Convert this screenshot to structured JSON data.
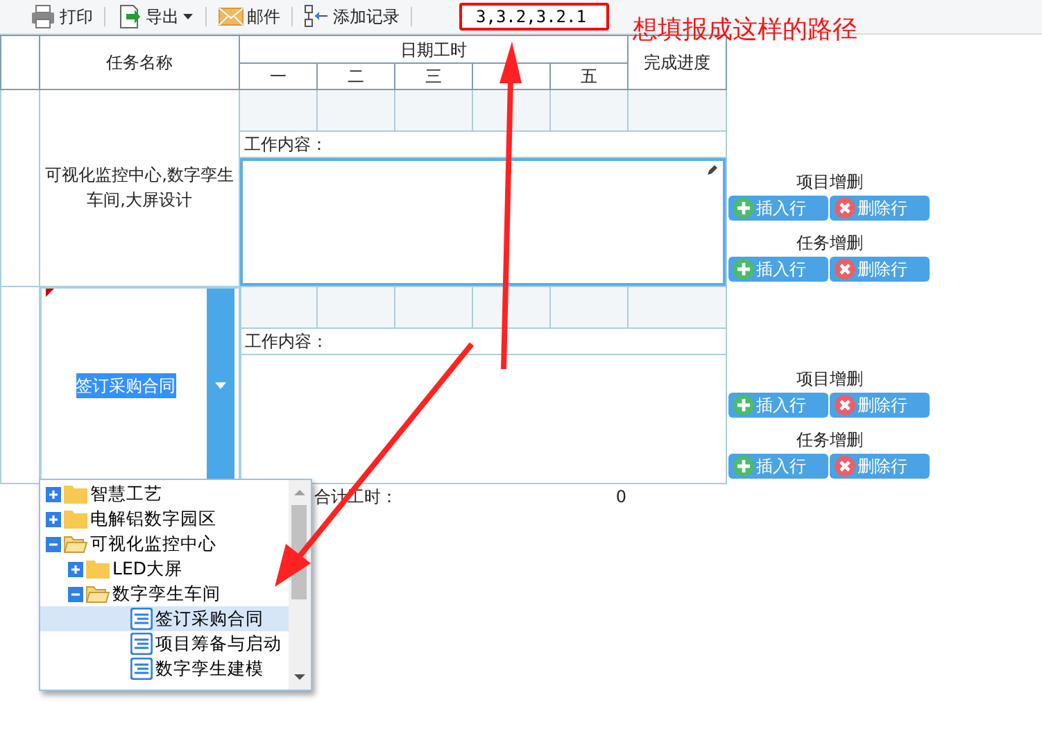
{
  "toolbar": [
    {
      "kind": "print",
      "label": "打印",
      "caret": false
    },
    {
      "kind": "export",
      "label": "导出",
      "caret": true
    },
    {
      "kind": "mail",
      "label": "邮件",
      "caret": false
    },
    {
      "kind": "add",
      "label": "添加记录",
      "caret": false
    }
  ],
  "path_field": {
    "value": "3,3.2,3.2.1"
  },
  "annotation": {
    "text": "想填报成这样的路径"
  },
  "table": {
    "columns": {
      "task": "任务名称",
      "dates": "日期工时",
      "days": [
        {
          "label": "一"
        },
        {
          "label": "二"
        },
        {
          "label": "三"
        },
        {
          "label": "五",
          "gap_before": true
        }
      ],
      "progress": "完成进度"
    },
    "rows": [
      {
        "task": "可视化监控中心,数字孪生车间,大屏设计",
        "selected": false,
        "editing": true,
        "work_label": "工作内容：",
        "actions": [
          {
            "label": "项目增删",
            "buttons": [
              {
                "kind": "insert",
                "label": "插入行"
              },
              {
                "kind": "delete",
                "label": "删除行"
              }
            ]
          },
          {
            "label": "任务增删",
            "buttons": [
              {
                "kind": "insert",
                "label": "插入行"
              },
              {
                "kind": "delete",
                "label": "删除行"
              }
            ]
          }
        ]
      },
      {
        "task": "签订采购合同",
        "selected": true,
        "editing": false,
        "work_label": "工作内容：",
        "actions": [
          {
            "label": "项目增删",
            "buttons": [
              {
                "kind": "insert",
                "label": "插入行"
              },
              {
                "kind": "delete",
                "label": "删除行"
              }
            ]
          },
          {
            "label": "任务增删",
            "buttons": [
              {
                "kind": "insert",
                "label": "插入行"
              },
              {
                "kind": "delete",
                "label": "删除行"
              }
            ]
          }
        ]
      }
    ],
    "total": {
      "label": "合计工时：",
      "value": "0"
    }
  },
  "tree": {
    "items": [
      {
        "label": "智慧工艺",
        "kind": "folder",
        "expanded": false,
        "selected": false
      },
      {
        "label": "电解铝数字园区",
        "kind": "folder",
        "expanded": false,
        "selected": false
      },
      {
        "label": "可视化监控中心",
        "kind": "folder",
        "expanded": true,
        "selected": false,
        "children": [
          {
            "label": "LED大屏",
            "kind": "folder",
            "expanded": false,
            "selected": false
          },
          {
            "label": "数字孪生车间",
            "kind": "folder",
            "expanded": true,
            "selected": false,
            "children": [
              {
                "label": "签订采购合同",
                "kind": "leaf",
                "selected": true
              },
              {
                "label": "项目筹备与启动",
                "kind": "leaf",
                "selected": false
              },
              {
                "label": "数字孪生建模",
                "kind": "leaf",
                "selected": false
              }
            ]
          }
        ]
      }
    ]
  }
}
